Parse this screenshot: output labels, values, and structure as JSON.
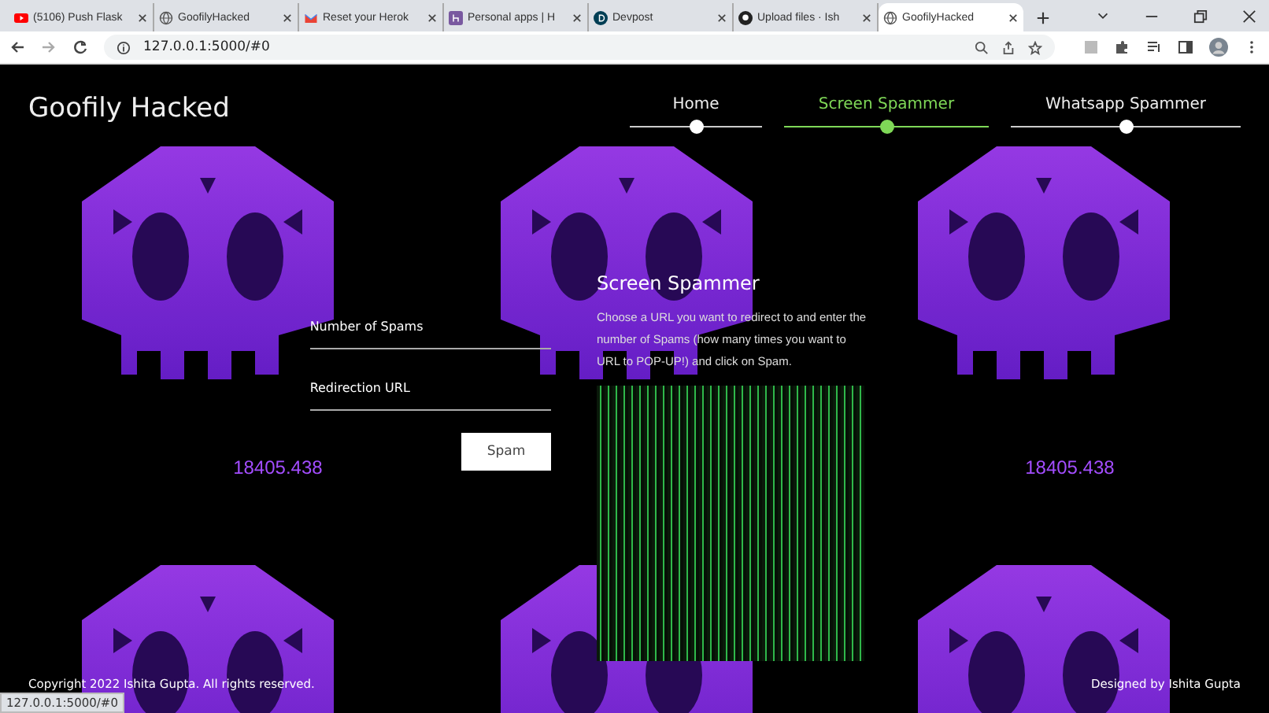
{
  "browser": {
    "tabs": [
      {
        "kind": "youtube",
        "label": "(5106) Push Flask",
        "selected": false
      },
      {
        "kind": "globe",
        "label": "GoofilyHacked",
        "selected": false
      },
      {
        "kind": "mail",
        "label": "Reset your Herok",
        "selected": false
      },
      {
        "kind": "heroku",
        "label": "Personal apps | H",
        "selected": false
      },
      {
        "kind": "devpost",
        "label": "Devpost",
        "selected": false
      },
      {
        "kind": "github",
        "label": "Upload files · Ish",
        "selected": false
      },
      {
        "kind": "globe",
        "label": "GoofilyHacked",
        "selected": true
      }
    ],
    "address": "127.0.0.1:5000/#0"
  },
  "page": {
    "brand": "Goofily Hacked",
    "nav": [
      {
        "label": "Home",
        "selected": false
      },
      {
        "label": "Screen Spammer",
        "selected": true
      },
      {
        "label": "Whatsapp Spammer",
        "selected": false
      }
    ],
    "counters": [
      "18405.438",
      "18405.438"
    ],
    "form": {
      "fields": [
        {
          "label": "Number of Spams"
        },
        {
          "label": "Redirection URL"
        }
      ],
      "button": "Spam"
    },
    "info": {
      "title": "Screen Spammer",
      "text": "Choose a URL you want to redirect to and enter the number of Spams (how many times you want to URL to POP-UP!) and click on Spam."
    },
    "footer": {
      "left": "Copyright 2022 Ishita Gupta. All rights reserved.",
      "right": "Designed by Ishita Gupta"
    }
  },
  "status_url": "127.0.0.1:5000/#0"
}
